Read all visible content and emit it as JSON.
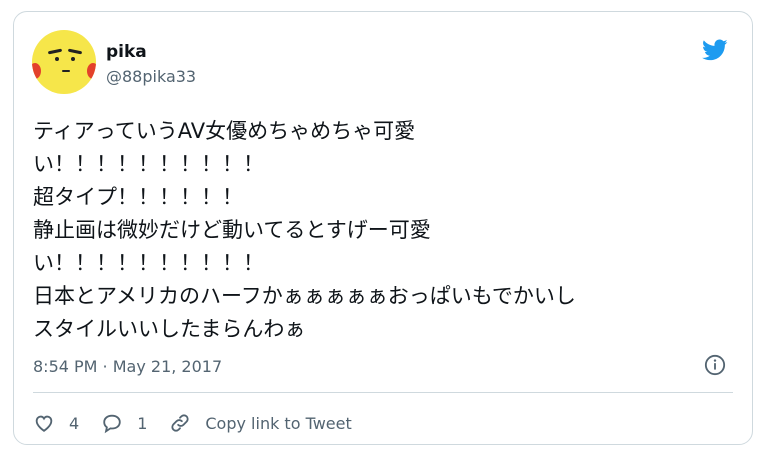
{
  "user": {
    "name": "pika",
    "handle": "@88pika33"
  },
  "tweet": {
    "text": "ティアっていうAV女優めちゃめちゃ可愛\nい！！！！！！！！！！\n超タイプ！！！！！！\n静止画は微妙だけど動いてるとすげー可愛\nい！！！！！！！！！！\n日本とアメリカのハーフかぁぁぁぁぁおっぱいもでかいし\nスタイルいいしたまらんわぁ",
    "timestamp": "8:54 PM · May 21, 2017"
  },
  "actions": {
    "likes": "4",
    "replies": "1",
    "copy_label": "Copy link to Tweet"
  },
  "icons": {
    "brand": "twitter-bird-icon",
    "info": "info-icon",
    "like": "heart-icon",
    "reply": "reply-bubble-icon",
    "link": "link-icon"
  },
  "colors": {
    "brand": "#1d9bf0",
    "secondary_text": "#536471",
    "border": "#cfd9de"
  }
}
